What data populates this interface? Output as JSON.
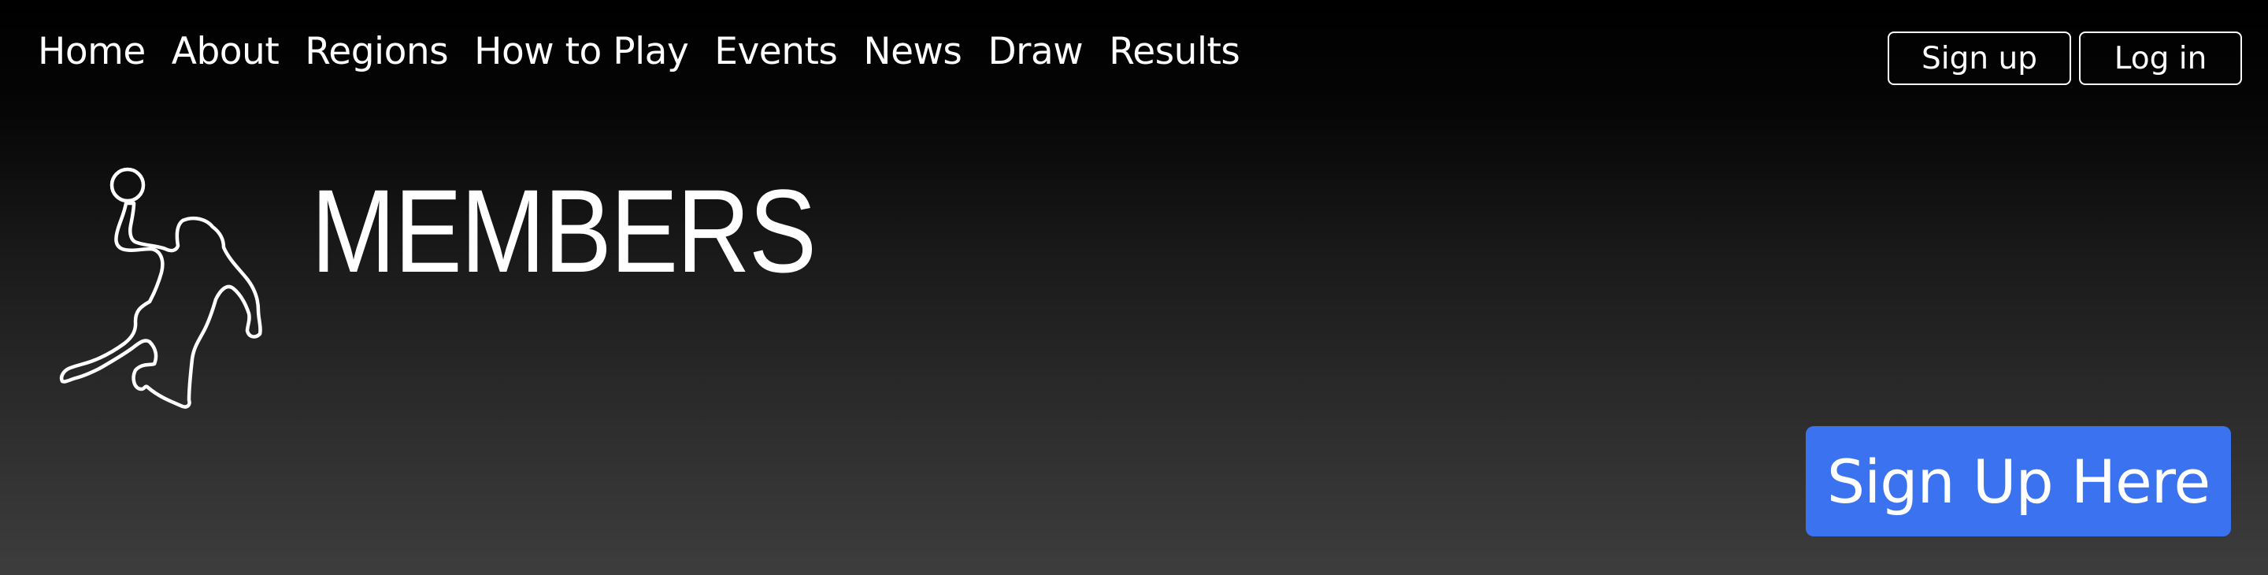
{
  "nav": {
    "items": [
      {
        "label": "Home"
      },
      {
        "label": "About"
      },
      {
        "label": "Regions"
      },
      {
        "label": "How to Play"
      },
      {
        "label": "Events"
      },
      {
        "label": "News"
      },
      {
        "label": "Draw"
      },
      {
        "label": "Results"
      }
    ]
  },
  "auth": {
    "signup_label": "Sign up",
    "login_label": "Log in"
  },
  "hero": {
    "logo_icon": "handball-player-icon",
    "title": "MEMBERS",
    "cta_label": "Sign Up Here"
  },
  "colors": {
    "background_top": "#000000",
    "background_bottom": "#3d3d3d",
    "cta": "#3b72f0",
    "text": "#ffffff"
  }
}
